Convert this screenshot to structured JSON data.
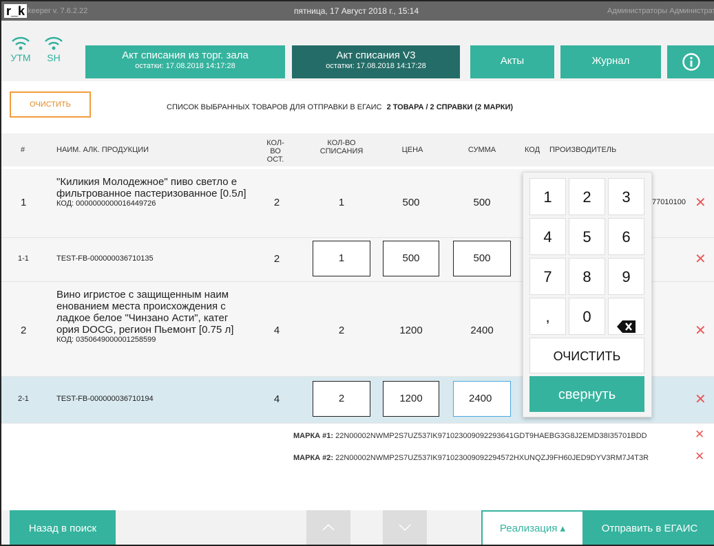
{
  "titlebar": {
    "brand": "r_k",
    "version": "keeper v. 7.6.2.22",
    "datetime": "пятница, 17 Август 2018 г., 15:14",
    "user": "Администраторы Администрат"
  },
  "status": [
    {
      "label": "УТМ",
      "icon": "wifi-icon"
    },
    {
      "label": "SH",
      "icon": "wifi-icon"
    }
  ],
  "header_buttons": [
    {
      "title": "Акт списания из торг. зала",
      "sub": "остатки: 17.08.2018 14:17:28"
    },
    {
      "title": "Акт списания V3",
      "sub": "остатки: 17.08.2018 14:17:28"
    },
    {
      "title": "Акты"
    },
    {
      "title": "Журнал"
    }
  ],
  "info_icon": "info-icon",
  "subheader": {
    "clear": "ОЧИСТИТЬ",
    "list_title": "СПИСОК ВЫБРАННЫХ ТОВАРОВ ДЛЯ ОТПРАВКИ В ЕГАИС",
    "summary": "2 ТОВАРА / 2 СПРАВКИ   (2 МАРКИ)"
  },
  "columns": {
    "num": "#",
    "name": "НАИМ. АЛК. ПРОДУКЦИИ",
    "stock_1": "КОЛ-ВО",
    "stock_2": "ОСТ.",
    "writeoff_1": "КОЛ-ВО",
    "writeoff_2": "СПИСАНИЯ",
    "price": "ЦЕНА",
    "sum": "СУММА",
    "code": "КОД",
    "maker": "ПРОИЗВОДИТЕЛЬ"
  },
  "rows": [
    {
      "num": "1",
      "name": "\"Киликия Молодежное\" пиво светло е фильтрованное пастеризованное [0.5л]",
      "code": "КОД: 0000000000016449726",
      "stock": "2",
      "writeoff": "1",
      "price": "500",
      "sum": "500",
      "maker_tail": "77010100"
    },
    {
      "num": "1-1",
      "barcode": "TEST-FB-000000036710135",
      "stock": "2",
      "writeoff": "1",
      "price": "500",
      "sum": "500"
    },
    {
      "num": "2",
      "name": "Вино игристое с защищенным наим енованием места происхождения с ладкое белое \"Чинзано Асти\", катег ория DOCG, регион Пьемонт [0.75 л]",
      "code": "КОД: 0350649000001258599",
      "stock": "4",
      "writeoff": "2",
      "price": "1200",
      "sum": "2400"
    },
    {
      "num": "2-1",
      "barcode": "TEST-FB-000000036710194",
      "stock": "4",
      "writeoff": "2",
      "price": "1200",
      "sum": "2400"
    }
  ],
  "marks": [
    {
      "label": "МАРКА #1:",
      "value": "22N00002NWMP2S7UZ537IK971023009092293641GDT9HAEBG3G8J2EMD38I35701BDD"
    },
    {
      "label": "МАРКА #2:",
      "value": "22N00002NWMP2S7UZ537IK971023009092294572HXUNQZJ9FH60JED9DYV3RM7J4T3R"
    }
  ],
  "numpad": {
    "keys": [
      "1",
      "2",
      "3",
      "4",
      "5",
      "6",
      "7",
      "8",
      "9",
      ",",
      "0"
    ],
    "backspace_icon": "backspace-icon",
    "clear": "ОЧИСТИТЬ",
    "collapse": "свернуть"
  },
  "footer": {
    "back": "Назад в поиск",
    "up_icon": "chevron-up-icon",
    "down_icon": "chevron-down-icon",
    "mode": "Реализация ▴",
    "send": "Отправить в ЕГАИС"
  },
  "colors": {
    "accent": "#35b39e",
    "accent_dark": "#246c67",
    "orange": "#f39c3d",
    "delete": "#e95a5a"
  }
}
